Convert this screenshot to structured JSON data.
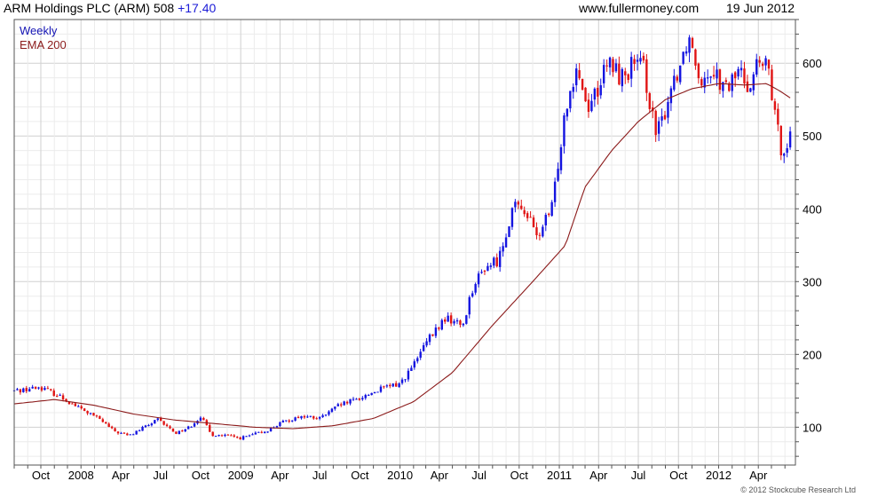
{
  "header": {
    "symbol_title": "ARM Holdings PLC (ARM) 508",
    "change": "+17.40",
    "site": "www.fullermoney.com",
    "date": "19 Jun 2012"
  },
  "footer": {
    "copyright": "© 2012 Stockcube Research Ltd"
  },
  "colors": {
    "up": "#1414e0",
    "down": "#e01414",
    "ema": "#8b1a1a",
    "grid": "#d9d9d9",
    "legend_weekly": "#1414b4",
    "legend_ema": "#8b1a1a"
  },
  "chart_data": {
    "type": "candlestick",
    "title": "ARM Holdings PLC (ARM) 508",
    "interval": "Weekly",
    "legend": [
      "Weekly",
      "EMA 200"
    ],
    "x_tick_labels": [
      "Oct",
      "2008",
      "Apr",
      "Jul",
      "Oct",
      "2009",
      "Apr",
      "Jul",
      "Oct",
      "2010",
      "Apr",
      "Jul",
      "Oct",
      "2011",
      "Apr",
      "Jul",
      "Oct",
      "2012",
      "Apr"
    ],
    "y_tick_labels": [
      100,
      200,
      300,
      400,
      500,
      600
    ],
    "ylim": [
      48,
      660
    ],
    "y_axis_side": "right",
    "grid": true,
    "price_anchors": [
      [
        "2007-08-01",
        150
      ],
      [
        "2007-10-01",
        155
      ],
      [
        "2007-11-15",
        142
      ],
      [
        "2008-01-01",
        125
      ],
      [
        "2008-02-15",
        110
      ],
      [
        "2008-03-15",
        95
      ],
      [
        "2008-04-20",
        88
      ],
      [
        "2008-05-25",
        100
      ],
      [
        "2008-06-25",
        110
      ],
      [
        "2008-08-05",
        92
      ],
      [
        "2008-09-05",
        100
      ],
      [
        "2008-10-01",
        115
      ],
      [
        "2008-10-25",
        90
      ],
      [
        "2008-12-01",
        88
      ],
      [
        "2009-01-01",
        85
      ],
      [
        "2009-02-01",
        90
      ],
      [
        "2009-03-01",
        95
      ],
      [
        "2009-04-01",
        105
      ],
      [
        "2009-05-15",
        115
      ],
      [
        "2009-07-01",
        112
      ],
      [
        "2009-08-15",
        130
      ],
      [
        "2009-10-01",
        140
      ],
      [
        "2009-11-15",
        152
      ],
      [
        "2010-01-01",
        160
      ],
      [
        "2010-02-01",
        185
      ],
      [
        "2010-03-01",
        215
      ],
      [
        "2010-04-15",
        250
      ],
      [
        "2010-05-25",
        240
      ],
      [
        "2010-06-15",
        290
      ],
      [
        "2010-07-15",
        320
      ],
      [
        "2010-08-15",
        330
      ],
      [
        "2010-09-15",
        400
      ],
      [
        "2010-10-15",
        400
      ],
      [
        "2010-11-10",
        360
      ],
      [
        "2010-12-15",
        400
      ],
      [
        "2011-01-15",
        540
      ],
      [
        "2011-02-10",
        600
      ],
      [
        "2011-03-05",
        540
      ],
      [
        "2011-03-25",
        560
      ],
      [
        "2011-04-25",
        600
      ],
      [
        "2011-05-25",
        580
      ],
      [
        "2011-06-20",
        600
      ],
      [
        "2011-07-15",
        590
      ],
      [
        "2011-08-10",
        500
      ],
      [
        "2011-08-25",
        520
      ],
      [
        "2011-09-15",
        570
      ],
      [
        "2011-10-05",
        600
      ],
      [
        "2011-10-25",
        640
      ],
      [
        "2011-11-20",
        580
      ],
      [
        "2011-12-20",
        595
      ],
      [
        "2012-01-15",
        560
      ],
      [
        "2012-02-15",
        590
      ],
      [
        "2012-03-10",
        570
      ],
      [
        "2012-03-30",
        600
      ],
      [
        "2012-04-25",
        590
      ],
      [
        "2012-05-10",
        520
      ],
      [
        "2012-05-25",
        480
      ],
      [
        "2012-06-19",
        508
      ]
    ],
    "ema_anchors": [
      [
        "2007-08-01",
        132
      ],
      [
        "2007-11-01",
        138
      ],
      [
        "2008-02-01",
        130
      ],
      [
        "2008-05-01",
        118
      ],
      [
        "2008-08-01",
        110
      ],
      [
        "2008-11-01",
        105
      ],
      [
        "2009-02-01",
        100
      ],
      [
        "2009-05-01",
        98
      ],
      [
        "2009-08-01",
        102
      ],
      [
        "2009-11-01",
        112
      ],
      [
        "2010-02-01",
        135
      ],
      [
        "2010-05-01",
        175
      ],
      [
        "2010-08-01",
        240
      ],
      [
        "2010-11-01",
        300
      ],
      [
        "2011-01-15",
        350
      ],
      [
        "2011-03-01",
        430
      ],
      [
        "2011-05-01",
        480
      ],
      [
        "2011-07-01",
        520
      ],
      [
        "2011-09-01",
        550
      ],
      [
        "2011-11-01",
        565
      ],
      [
        "2012-01-01",
        572
      ],
      [
        "2012-03-01",
        570
      ],
      [
        "2012-04-20",
        572
      ],
      [
        "2012-05-20",
        562
      ],
      [
        "2012-06-19",
        550
      ]
    ]
  }
}
